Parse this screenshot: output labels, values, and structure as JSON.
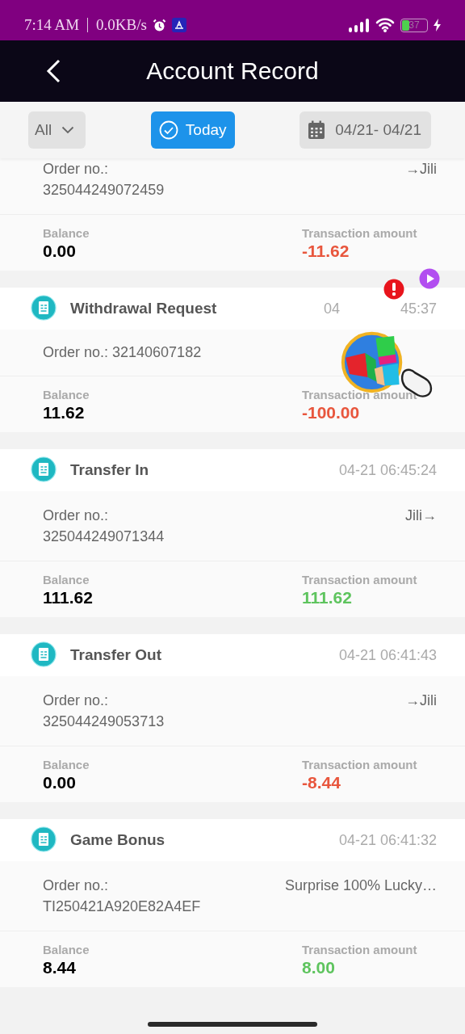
{
  "status_bar": {
    "time": "7:14 AM",
    "speed": "0.0KB/s",
    "battery": "37"
  },
  "header": {
    "title": "Account Record"
  },
  "filters": {
    "type": {
      "label": "All"
    },
    "today": {
      "label": "Today",
      "selected": true
    },
    "range": {
      "label": "04/21- 04/21",
      "selected": false
    }
  },
  "records": [
    {
      "order_label": "Order no.:",
      "order_no": "325044249072459",
      "note": "→Jili",
      "balance_label": "Balance",
      "balance": "0.00",
      "amount_label": "Transaction amount",
      "amount": "-11.62",
      "kind": "debit"
    },
    {
      "title": "Withdrawal Request",
      "time_parts": [
        "04",
        "45:37"
      ],
      "order_label": "Order no.:",
      "order_no": "32140607182",
      "balance_label": "Balance",
      "balance": "11.62",
      "amount_label": "Transaction amount",
      "amount": "-100.00",
      "kind": "debit"
    },
    {
      "title": "Transfer In",
      "time_parts": [
        "04-21 06:45:24"
      ],
      "order_label": "Order no.:",
      "order_no": "325044249071344",
      "note": "Jili→",
      "balance_label": "Balance",
      "balance": "111.62",
      "amount_label": "Transaction amount",
      "amount": "111.62",
      "kind": "credit"
    },
    {
      "title": "Transfer Out",
      "time_parts": [
        "04-21 06:41:43"
      ],
      "order_label": "Order no.:",
      "order_no": "325044249053713",
      "note": "→Jili",
      "balance_label": "Balance",
      "balance": "0.00",
      "amount_label": "Transaction amount",
      "amount": "-8.44",
      "kind": "debit"
    },
    {
      "title": "Game Bonus",
      "time_parts": [
        "04-21 06:41:32"
      ],
      "order_label": "Order no.:",
      "order_no": "TI250421A920E82A4EF",
      "note": "Surprise 100% Lucky…",
      "balance_label": "Balance",
      "balance": "8.44",
      "amount_label": "Transaction amount",
      "amount": "8.00",
      "kind": "credit"
    }
  ]
}
